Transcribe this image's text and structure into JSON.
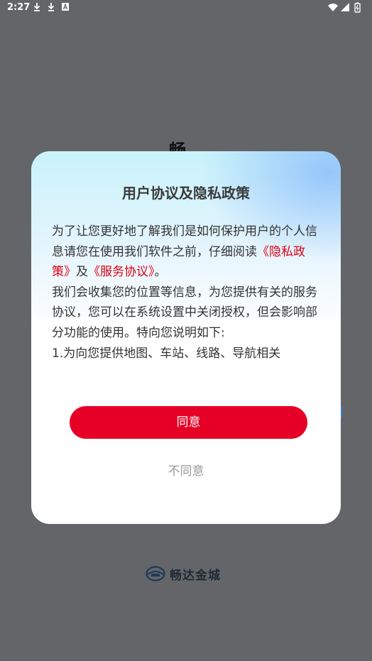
{
  "status_bar": {
    "time": "2:27",
    "icons": [
      "download-icon",
      "download-icon",
      "font-a-icon",
      "wifi-icon",
      "cell-signal-icon",
      "battery-icon"
    ]
  },
  "background": {
    "partial_title": "畅",
    "app_name": "畅达金城"
  },
  "dialog": {
    "title": "用户协议及隐私政策",
    "intro_before": "为了让您更好地了解我们是如何保护用户的个人信息请您在使用我们软件之前，仔细阅读",
    "privacy_link": "《隐私政策》",
    "and": "及",
    "service_link": "《服务协议》",
    "intro_end": "。",
    "para2": "我们会收集您的位置等信息，为您提供有关的服务协议，您可以在系统设置中关闭授权，但会影响部分功能的使用。特向您说明如下:",
    "para3": "1.为向您提供地图、车站、线路、导航相关",
    "agree_label": "同意",
    "disagree_label": "不同意"
  },
  "colors": {
    "accent": "#e60026",
    "link": "#e00014",
    "overlay": "#636569"
  }
}
